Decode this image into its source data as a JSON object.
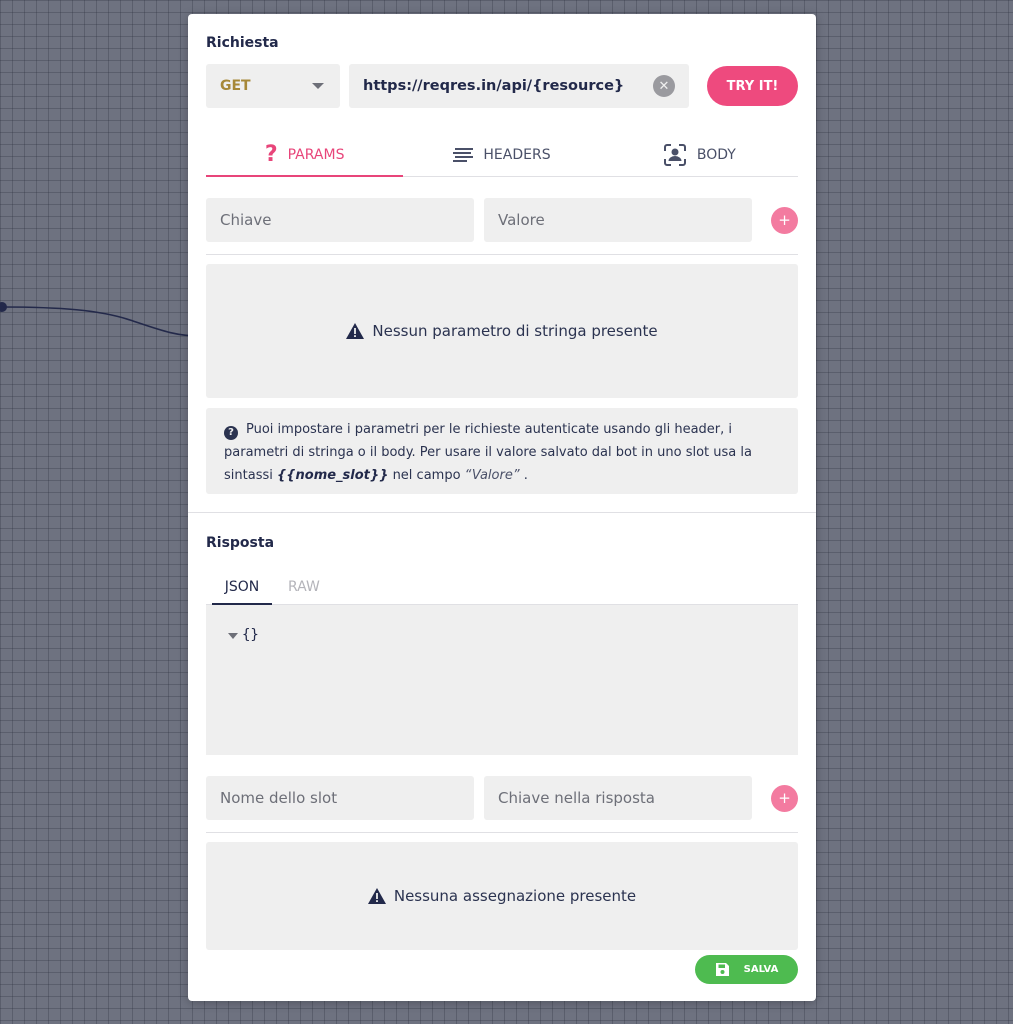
{
  "request": {
    "title": "Richiesta",
    "method": "GET",
    "url": "https://reqres.in/api/{resource}",
    "try_label": "TRY IT!",
    "tabs": [
      {
        "label": "PARAMS",
        "icon": "question-icon",
        "active": true
      },
      {
        "label": "HEADERS",
        "icon": "lines-icon",
        "active": false
      },
      {
        "label": "BODY",
        "icon": "user-scan-icon",
        "active": false
      }
    ],
    "key_placeholder": "Chiave",
    "value_placeholder": "Valore",
    "empty_params": "Nessun parametro di stringa presente",
    "info": {
      "text_1": "Puoi impostare i parametri per le richieste autenticate usando gli header, i parametri di stringa o il body. Per usare il valore salvato dal bot in uno slot usa la sintassi",
      "syntax": "{{nome_slot}}",
      "text_2": "nel campo",
      "field": "“Valore”",
      "text_3": "."
    }
  },
  "response": {
    "title": "Risposta",
    "tabs": [
      {
        "label": "JSON",
        "active": true
      },
      {
        "label": "RAW",
        "active": false
      }
    ],
    "json_preview": "{}",
    "slot_placeholder": "Nome dello slot",
    "resp_key_placeholder": "Chiave nella risposta",
    "empty_assign": "Nessuna assegnazione presente",
    "save_label": "SALVA"
  },
  "colors": {
    "accent": "#ee4a7e",
    "save": "#4ebb50",
    "method": "#a78838"
  }
}
